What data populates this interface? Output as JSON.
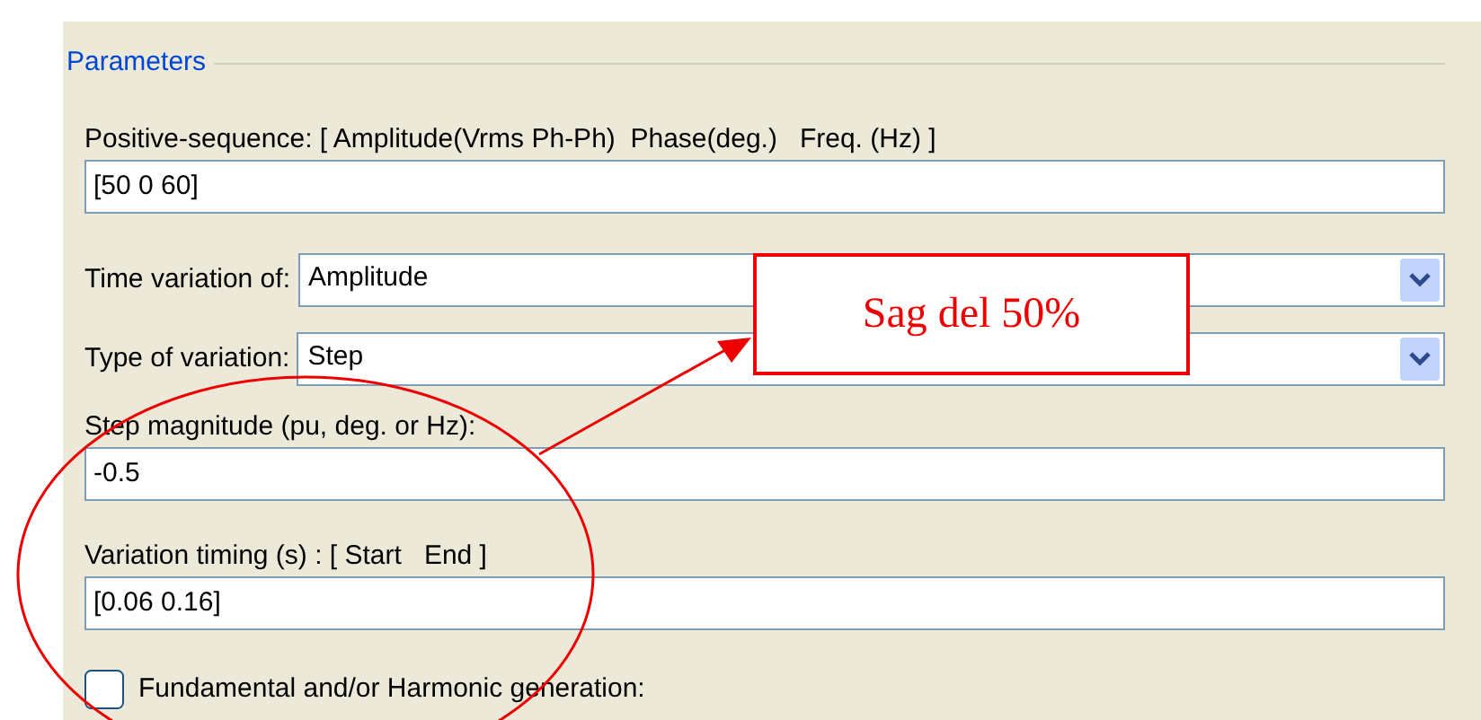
{
  "group": {
    "title": "Parameters"
  },
  "fields": [
    {
      "kind": "text",
      "label": "Positive-sequence: [ Amplitude(Vrms Ph-Ph)  Phase(deg.)   Freq. (Hz) ]",
      "value": "[50 0 60]"
    },
    {
      "kind": "dropdown",
      "label": "Time variation of:",
      "value": "Amplitude"
    },
    {
      "kind": "dropdown",
      "label": "Type of variation:",
      "value": "Step"
    },
    {
      "kind": "text",
      "label": "Step magnitude (pu, deg. or Hz):",
      "value": "-0.5"
    },
    {
      "kind": "text",
      "label": "Variation timing (s) : [ Start   End ]",
      "value": "[0.06 0.16]"
    }
  ],
  "checkbox": {
    "label": "Fundamental and/or Harmonic generation:",
    "checked": false
  },
  "annotation": {
    "text": "Sag del 50%"
  }
}
